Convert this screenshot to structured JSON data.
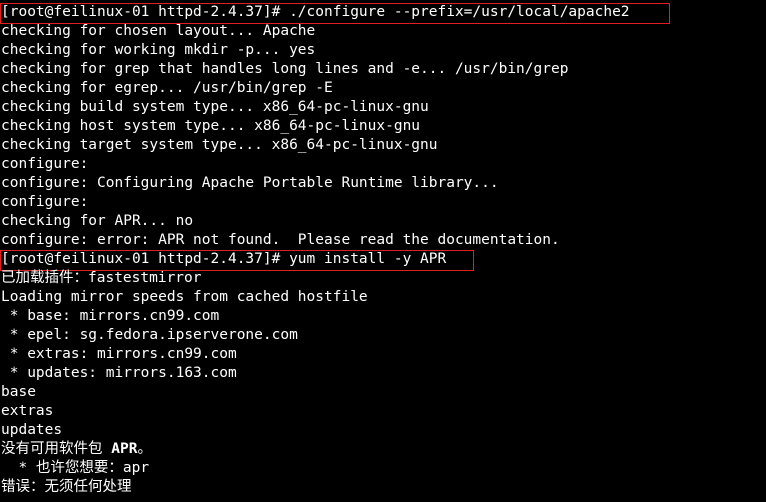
{
  "terminal": {
    "lines": [
      "[root@feilinux-01 httpd-2.4.37]# ./configure --prefix=/usr/local/apache2",
      "checking for chosen layout... Apache",
      "checking for working mkdir -p... yes",
      "checking for grep that handles long lines and -e... /usr/bin/grep",
      "checking for egrep... /usr/bin/grep -E",
      "checking build system type... x86_64-pc-linux-gnu",
      "checking host system type... x86_64-pc-linux-gnu",
      "checking target system type... x86_64-pc-linux-gnu",
      "configure:",
      "configure: Configuring Apache Portable Runtime library...",
      "configure:",
      "checking for APR... no",
      "configure: error: APR not found.  Please read the documentation.",
      "[root@feilinux-01 httpd-2.4.37]# yum install -y APR",
      "已加载插件：fastestmirror",
      "Loading mirror speeds from cached hostfile",
      " * base: mirrors.cn99.com",
      " * epel: sg.fedora.ipserverone.com",
      " * extras: mirrors.cn99.com",
      " * updates: mirrors.163.com",
      "base",
      "extras",
      "updates",
      "没有可用软件包 ",
      "  * 也许您想要：apr",
      "错误：无须任何处理"
    ],
    "line23_bold": "APR",
    "line23_tail": "。",
    "colors": {
      "background": "#000000",
      "text": "#ffffff",
      "annotation": "#e02020"
    }
  }
}
